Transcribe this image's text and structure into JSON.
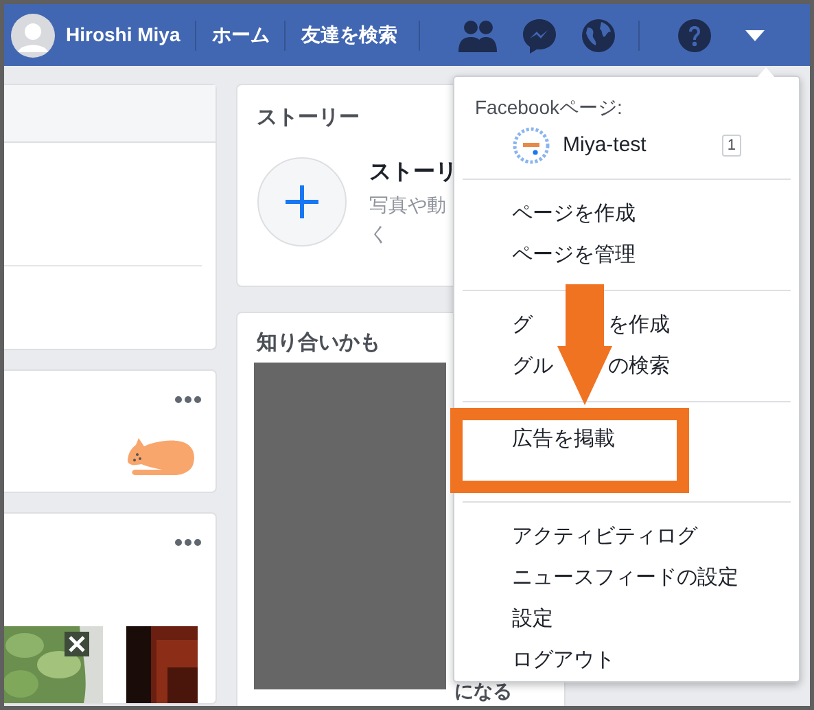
{
  "top_bar": {
    "user_name": "Hiroshi Miya",
    "nav": [
      {
        "label": "ホーム"
      },
      {
        "label": "友達を検索"
      }
    ]
  },
  "stories": {
    "title": "ストーリー",
    "add_title": "ストーリ",
    "add_text": "写真や動",
    "add_text_2": "く"
  },
  "suggestions": {
    "title": "知り合いかも",
    "button_fragment": "になる"
  },
  "menu": {
    "section_title": "Facebookページ:",
    "page": {
      "name": "Miya-test",
      "count": "1"
    },
    "groups": [
      [
        {
          "label": "ページを作成",
          "annotated": false
        },
        {
          "label": "ページを管理",
          "annotated": false
        }
      ],
      [
        {
          "label_parts": [
            "グ",
            "を作成"
          ],
          "annotated": false
        },
        {
          "label_parts": [
            "グル",
            "の検索"
          ],
          "annotated": false
        }
      ],
      [
        {
          "label": "広告を掲載",
          "annotated": true
        }
      ],
      [
        {
          "label": "アクティビティログ",
          "annotated": false
        },
        {
          "label": "ニュースフィードの設定",
          "annotated": false
        },
        {
          "label": "設定",
          "annotated": false
        },
        {
          "label": "ログアウト",
          "annotated": false
        }
      ]
    ]
  }
}
